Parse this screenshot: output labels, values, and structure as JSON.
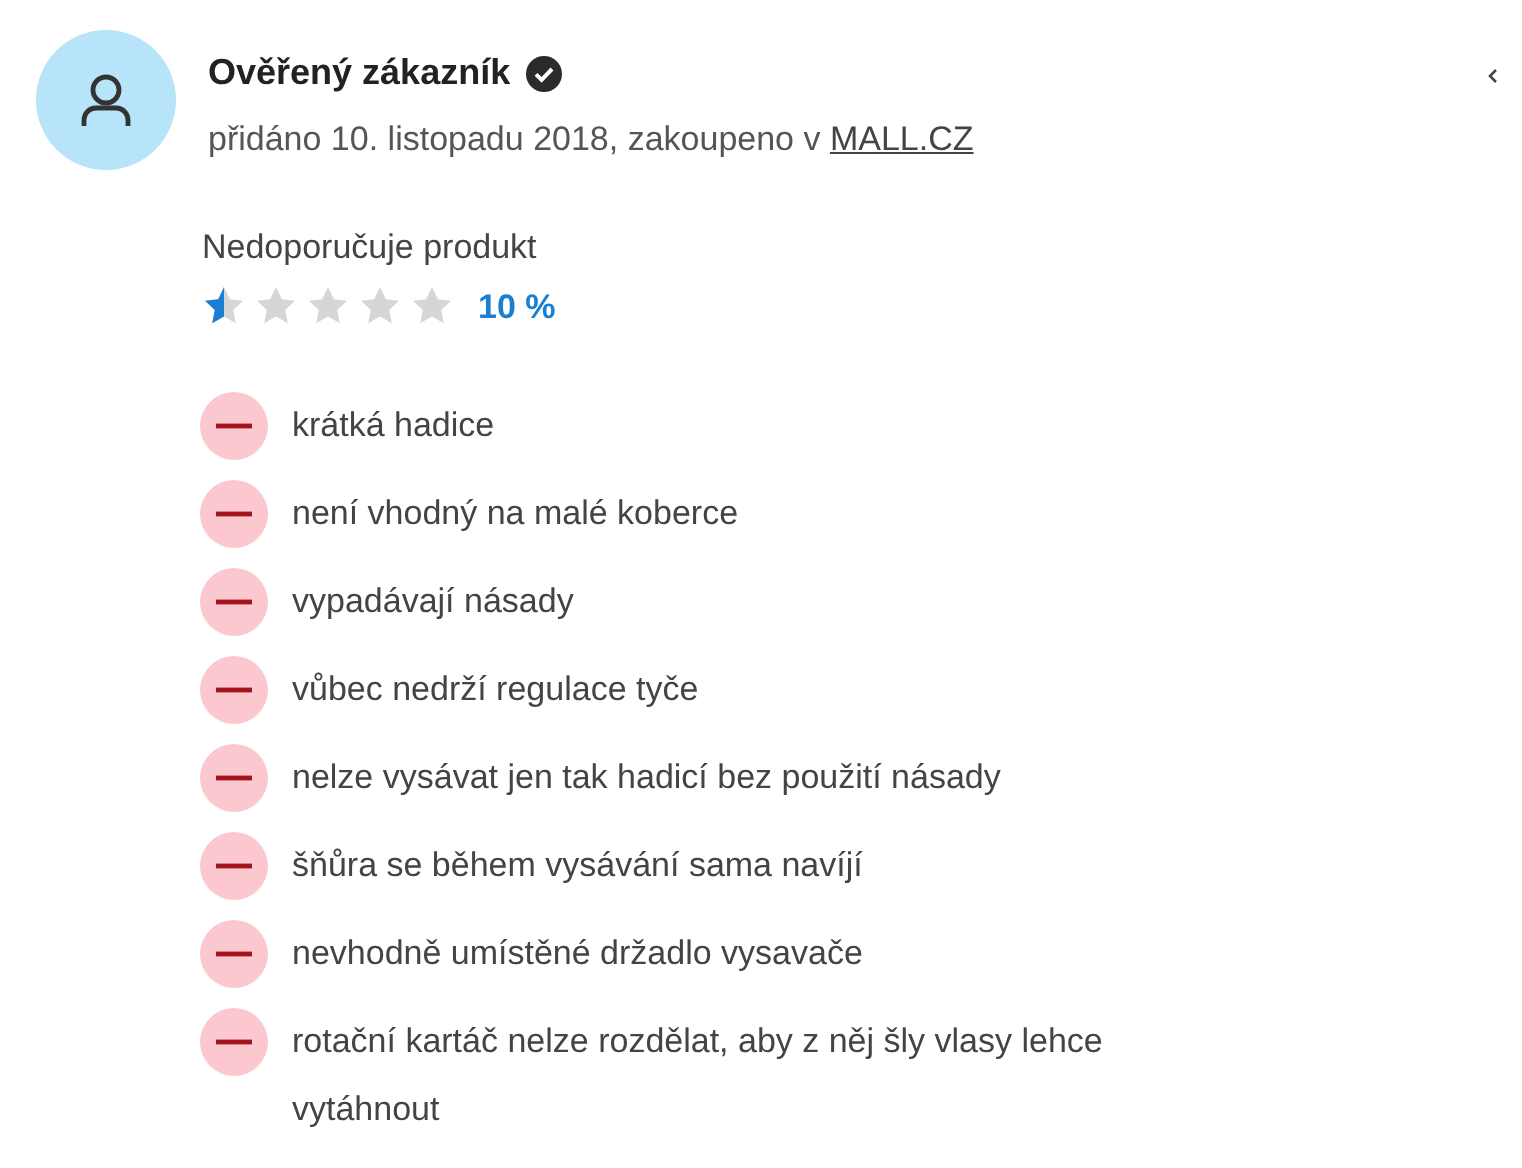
{
  "review": {
    "author": "Ověřený zákazník",
    "verified": true,
    "meta": "přidáno 10. listopadu 2018, zakoupeno v ",
    "shop": "MALL.CZ",
    "recommendation": "Nedoporučuje produkt",
    "stars": 0.5,
    "percent": "10 %"
  },
  "cons": [
    {
      "text": "krátká hadice"
    },
    {
      "text": "není vhodný na malé koberce"
    },
    {
      "text": "vypadávají násady"
    },
    {
      "text": "vůbec nedrží regulace tyče"
    },
    {
      "text": "nelze vysávat jen tak hadicí bez použití násady"
    },
    {
      "text": "šňůra se během vysávání sama navíjí"
    },
    {
      "text": "nevhodně umístěné držadlo vysavače"
    },
    {
      "text": "rotační kartáč nelze rozdělat, aby z něj šly vlasy lehce vytáhnout"
    }
  ]
}
